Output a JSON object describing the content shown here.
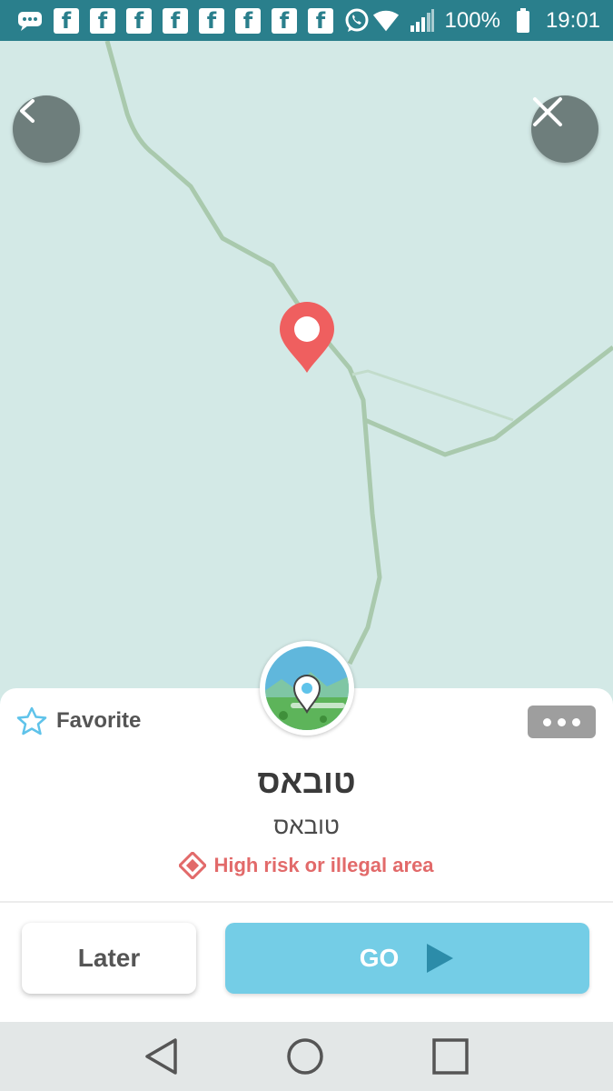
{
  "status_bar": {
    "notification_icons": [
      "message-icon",
      "facebook-icon",
      "facebook-icon",
      "facebook-icon",
      "facebook-icon",
      "facebook-icon",
      "facebook-icon",
      "facebook-icon",
      "facebook-icon",
      "whatsapp-icon"
    ],
    "facebook_glyph": "f",
    "battery": "100%",
    "time": "19:01"
  },
  "map": {
    "back_icon": "chevron-left-icon",
    "close_icon": "close-icon",
    "pin_color": "#ef5f5f",
    "road_color": "#a9c9ad"
  },
  "place": {
    "favorite_label": "Favorite",
    "title": "טובאס",
    "subtitle": "טובאס",
    "warning": "High risk or illegal area",
    "warning_color": "#e26a6a"
  },
  "actions": {
    "later_label": "Later",
    "go_label": "GO",
    "go_color": "#74cde6"
  },
  "nav_bar": {
    "icons": [
      "back-triangle-icon",
      "home-circle-icon",
      "recents-square-icon"
    ]
  }
}
